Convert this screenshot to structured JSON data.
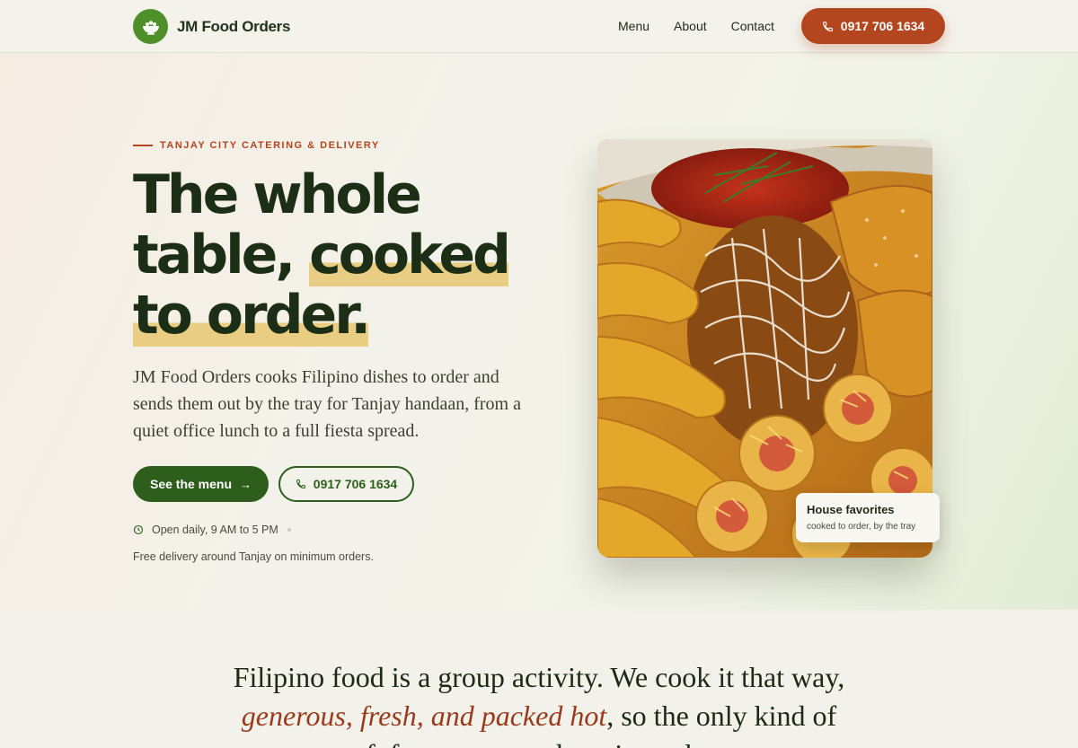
{
  "header": {
    "brand": "JM Food Orders",
    "logo_icon": "bowl-icon",
    "nav": [
      "Menu",
      "About",
      "Contact"
    ],
    "call_button": "0917 706 1634"
  },
  "hero": {
    "eyebrow": "TANJAY CITY CATERING & DELIVERY",
    "headline_line1": "The whole",
    "headline_line2a": "table, ",
    "headline_line2b": "cooked",
    "headline_line3": "to order.",
    "lede": "JM Food Orders cooks Filipino dishes to order and sends them out by the tray for Tanjay handaan, from a quiet office lunch to a full fiesta spread.",
    "cta_primary": "See the menu",
    "cta_secondary": "0917 706 1634",
    "hours": "Open daily, 9 AM to 5 PM",
    "delivery": "Free delivery around Tanjay on minimum orders.",
    "image_card": {
      "title": "House favorites",
      "subtitle": "cooked to order, by the tray"
    }
  },
  "statement": {
    "before": "Filipino food is a group activity. We cook it that way, ",
    "emphasis": "generous, fresh, and packed hot",
    "after": ", so the only kind of fofs you worry about is on the"
  },
  "colors": {
    "accent_green": "#2d5e1c",
    "accent_orange": "#b3451f",
    "highlight": "#e9cd82"
  }
}
